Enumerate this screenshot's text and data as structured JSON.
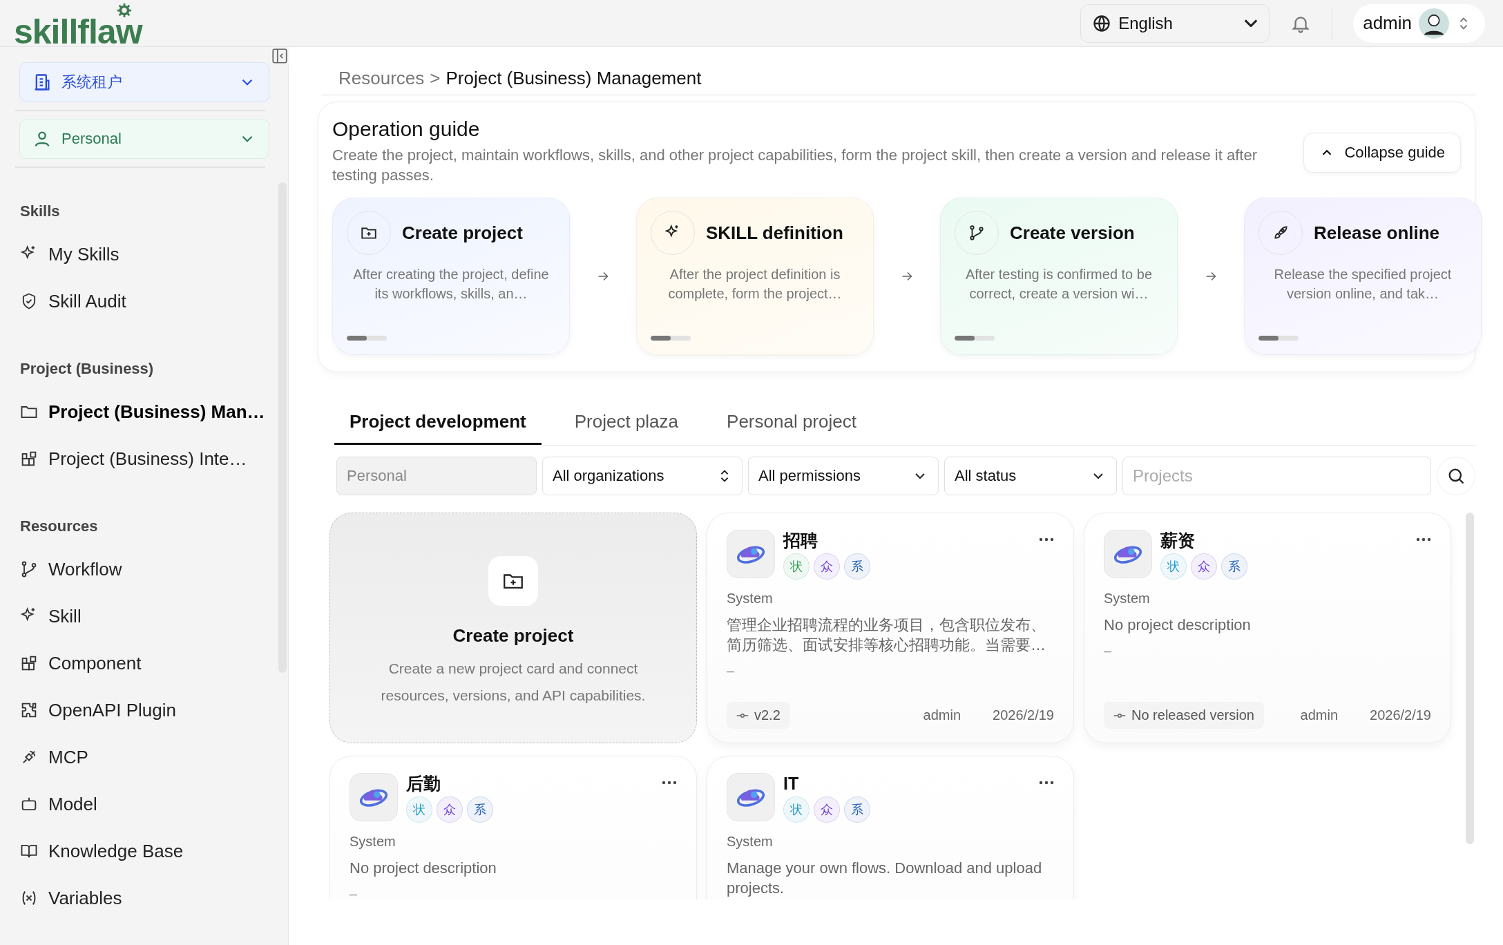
{
  "logo": {
    "text": "skillflaw"
  },
  "header": {
    "language": "English",
    "user": "admin"
  },
  "sidebar": {
    "tenant": "系统租户",
    "workspace": "Personal",
    "sections": [
      {
        "title": "Skills",
        "items": [
          {
            "label": "My Skills",
            "selected": false
          },
          {
            "label": "Skill Audit",
            "selected": false
          }
        ]
      },
      {
        "title": "Project (Business)",
        "items": [
          {
            "label": "Project (Business) Man…",
            "selected": true
          },
          {
            "label": "Project (Business) Inte…",
            "selected": false
          }
        ]
      },
      {
        "title": "Resources",
        "items": [
          {
            "label": "Workflow",
            "selected": false
          },
          {
            "label": "Skill",
            "selected": false
          },
          {
            "label": "Component",
            "selected": false
          },
          {
            "label": "OpenAPI Plugin",
            "selected": false
          },
          {
            "label": "MCP",
            "selected": false
          },
          {
            "label": "Model",
            "selected": false
          },
          {
            "label": "Knowledge Base",
            "selected": false
          },
          {
            "label": "Variables",
            "selected": false
          }
        ]
      }
    ]
  },
  "breadcrumb": {
    "parent": "Resources",
    "separator": ">",
    "current": "Project (Business) Management"
  },
  "guide": {
    "title": "Operation guide",
    "description": "Create the project, maintain workflows, skills, and other project capabilities, form the project skill, then create a version and release it after testing passes.",
    "collapse_button": "Collapse guide",
    "steps": [
      {
        "title": "Create project",
        "description": "After creating the project, define its workflows, skills, an…",
        "color": "#eef3ff",
        "level": 0.5
      },
      {
        "title": "SKILL definition",
        "description": "After the project definition is complete, form the project…",
        "color": "#fff8ea",
        "level": 0.5
      },
      {
        "title": "Create version",
        "description": "After testing is confirmed to be correct, create a version wi…",
        "color": "#eafaf2",
        "level": 0.5
      },
      {
        "title": "Release online",
        "description": "Release the specified project version online, and tak…",
        "color": "#f3f0ff",
        "level": 0.5
      }
    ]
  },
  "tabs": [
    {
      "label": "Project development",
      "selected": true
    },
    {
      "label": "Project plaza",
      "selected": false
    },
    {
      "label": "Personal project",
      "selected": false
    }
  ],
  "filters": {
    "scope": "Personal",
    "organization": "All organizations",
    "permission": "All permissions",
    "status": "All status",
    "search_placeholder": "Projects"
  },
  "create_card": {
    "title": "Create project",
    "description": "Create a new project card and connect resources, versions, and API capabilities."
  },
  "projects": [
    {
      "name": "招聘",
      "tags": [
        {
          "label": "状",
          "color": "#3aa55d"
        },
        {
          "label": "众",
          "color": "#6d3fd6"
        },
        {
          "label": "系",
          "color": "#2563b8"
        }
      ],
      "owner": "System",
      "description": "管理企业招聘流程的业务项目，包含职位发布、简历筛选、面试安排等核心招聘功能。当需要…",
      "extra": "–",
      "version": "v2.2",
      "author": "admin",
      "date": "2026/2/19"
    },
    {
      "name": "薪资",
      "tags": [
        {
          "label": "状",
          "color": "#2b9fc9"
        },
        {
          "label": "众",
          "color": "#6d3fd6"
        },
        {
          "label": "系",
          "color": "#2563b8"
        }
      ],
      "owner": "System",
      "description": "No project description",
      "extra": "–",
      "version": "No released version",
      "author": "admin",
      "date": "2026/2/19"
    },
    {
      "name": "后勤",
      "tags": [
        {
          "label": "状",
          "color": "#2b9fc9"
        },
        {
          "label": "众",
          "color": "#6d3fd6"
        },
        {
          "label": "系",
          "color": "#2563b8"
        }
      ],
      "owner": "System",
      "description": "No project description",
      "extra": "–"
    },
    {
      "name": "IT",
      "tags": [
        {
          "label": "状",
          "color": "#2b9fc9"
        },
        {
          "label": "众",
          "color": "#6d3fd6"
        },
        {
          "label": "系",
          "color": "#2563b8"
        }
      ],
      "owner": "System",
      "description": "Manage your own flows. Download and upload projects."
    }
  ]
}
